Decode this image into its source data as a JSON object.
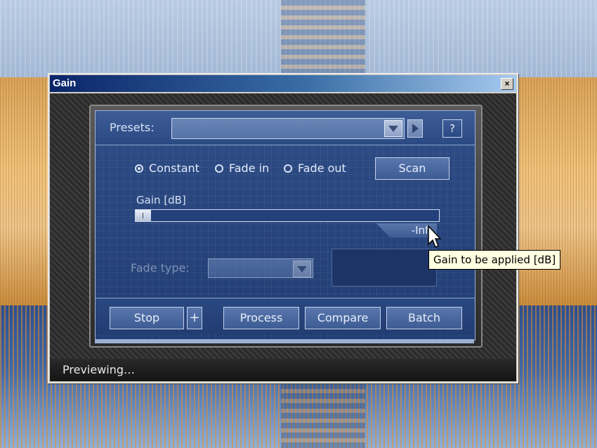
{
  "window": {
    "title": "Gain",
    "close_label": "×"
  },
  "presets": {
    "label": "Presets:",
    "selected": "",
    "help_label": "?"
  },
  "mode": {
    "options": [
      {
        "label": "Constant",
        "selected": true
      },
      {
        "label": "Fade in",
        "selected": false
      },
      {
        "label": "Fade out",
        "selected": false
      }
    ],
    "scan_label": "Scan"
  },
  "gain": {
    "label": "Gain [dB]",
    "readout": "-Inf.",
    "tooltip": "Gain to be applied [dB]"
  },
  "fade": {
    "label": "Fade type:",
    "selected": ""
  },
  "buttons": {
    "stop": "Stop",
    "plus": "+",
    "process": "Process",
    "compare": "Compare",
    "batch": "Batch"
  },
  "status": {
    "text": "Previewing…"
  },
  "colors": {
    "panel_blue": "#2e4d86",
    "titlebar": "#0a246a",
    "tooltip_bg": "#ffffe1"
  }
}
